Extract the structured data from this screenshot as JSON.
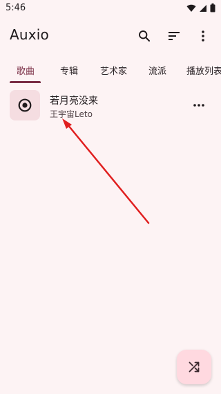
{
  "status_bar": {
    "time": "5:46",
    "icons": [
      "wifi-icon",
      "signal-icon",
      "battery-icon"
    ]
  },
  "app_bar": {
    "title": "Auxio",
    "actions": [
      "search-icon",
      "sort-icon",
      "more-vert-icon"
    ]
  },
  "tabs": [
    {
      "label": "歌曲",
      "active": true
    },
    {
      "label": "专辑",
      "active": false
    },
    {
      "label": "艺术家",
      "active": false
    },
    {
      "label": "流派",
      "active": false
    },
    {
      "label": "播放列表",
      "active": false
    }
  ],
  "songs": [
    {
      "title": "若月亮没来",
      "artist": "王宇宙Leto",
      "art_icon": "disc-icon",
      "menu_icon": "more-horiz-icon"
    }
  ],
  "fab": {
    "icon": "shuffle-icon"
  },
  "colors": {
    "background": "#fdf3f4",
    "accent": "#7a2e45",
    "art_background": "#f5dde1",
    "fab_background": "#ffd9e0",
    "annotation": "#e01f1f"
  }
}
